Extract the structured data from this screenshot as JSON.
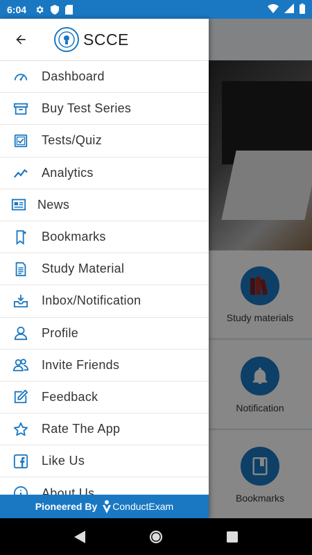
{
  "status_bar": {
    "time": "6:04",
    "icons": [
      "gear-icon",
      "shield-icon",
      "sd-card-icon",
      "wifi-icon",
      "signal-icon",
      "battery-icon"
    ]
  },
  "header": {
    "title": "SCCE",
    "back_icon": "arrow-back-icon"
  },
  "menu": [
    {
      "label": "Dashboard",
      "icon": "speedometer-icon"
    },
    {
      "label": "Buy Test Series",
      "icon": "cart-box-icon"
    },
    {
      "label": "Tests/Quiz",
      "icon": "quiz-check-icon"
    },
    {
      "label": "Analytics",
      "icon": "analytics-trend-icon"
    },
    {
      "label": "News",
      "icon": "newspaper-icon"
    },
    {
      "label": "Bookmarks",
      "icon": "bookmark-icon"
    },
    {
      "label": "Study Material",
      "icon": "document-icon"
    },
    {
      "label": "Inbox/Notification",
      "icon": "inbox-icon"
    },
    {
      "label": "Profile",
      "icon": "user-icon"
    },
    {
      "label": "Invite Friends",
      "icon": "users-icon"
    },
    {
      "label": "Feedback",
      "icon": "edit-icon"
    },
    {
      "label": "Rate The App",
      "icon": "star-icon"
    },
    {
      "label": "Like Us",
      "icon": "facebook-icon"
    },
    {
      "label": "About Us",
      "icon": "info-icon"
    }
  ],
  "footer": {
    "prefix": "Pioneered By",
    "brand": "ConductExam"
  },
  "background_cards": [
    {
      "label": "Study materials",
      "icon": "books-icon"
    },
    {
      "label": "Notification",
      "icon": "bell-icon"
    },
    {
      "label": "Bookmarks",
      "icon": "bookmark-book-icon"
    }
  ],
  "colors": {
    "accent": "#1a78c2",
    "overlay": "rgba(0,0,0,0.47)"
  }
}
